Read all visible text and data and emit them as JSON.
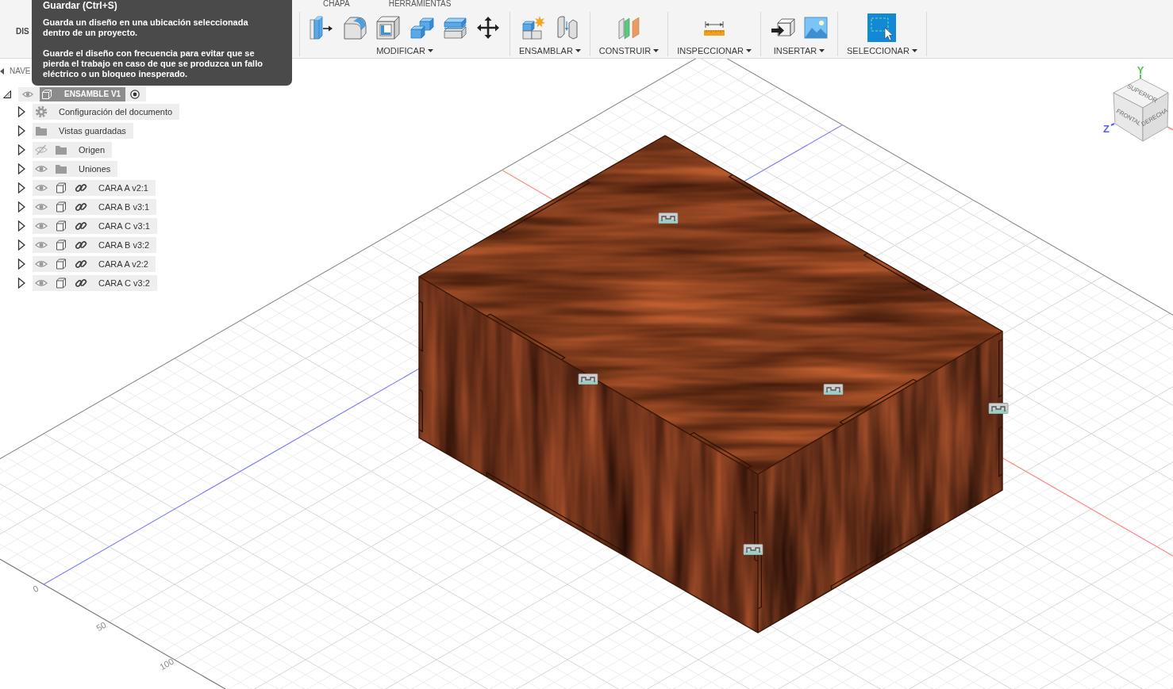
{
  "toolbar": {
    "workspace": "DIS",
    "tabs": [
      "CHAPA",
      "HERRAMIENTAS"
    ],
    "groups": [
      {
        "label": "MODIFICAR",
        "tools": [
          {
            "kind": "presspull"
          },
          {
            "kind": "fillet"
          },
          {
            "kind": "shell"
          },
          {
            "kind": "combine"
          },
          {
            "kind": "offset"
          },
          {
            "kind": "move"
          }
        ]
      },
      {
        "label": "ENSAMBLAR",
        "tools": [
          {
            "kind": "component"
          },
          {
            "kind": "joint"
          }
        ]
      },
      {
        "label": "CONSTRUIR",
        "tools": [
          {
            "kind": "plane"
          }
        ]
      },
      {
        "label": "INSPECCIONAR",
        "tools": [
          {
            "kind": "measure"
          }
        ]
      },
      {
        "label": "INSERTAR",
        "tools": [
          {
            "kind": "insert"
          },
          {
            "kind": "image"
          }
        ]
      },
      {
        "label": "SELECCIONAR",
        "tools": [
          {
            "kind": "select"
          }
        ]
      }
    ]
  },
  "tooltip": {
    "title": "Guardar (Ctrl+S)",
    "paragraphs": [
      "Guarda un diseño en una ubicación seleccionada dentro de un proyecto.",
      "Guarde el diseño con frecuencia para evitar que se pierda el trabajo en caso de que se produzca un fallo eléctrico o un bloqueo inesperado."
    ]
  },
  "browser": {
    "header": "NAVE",
    "root": {
      "label": "ENSAMBLE V1",
      "expanded": true,
      "visible": true,
      "children": [
        {
          "kind": "settings",
          "label": "Configuración del documento",
          "expanded": false
        },
        {
          "kind": "folder",
          "label": "Vistas guardadas",
          "expanded": false
        },
        {
          "kind": "folder",
          "label": "Origen",
          "expanded": false,
          "visible": false
        },
        {
          "kind": "folder",
          "label": "Uniones",
          "expanded": false,
          "visible": true
        },
        {
          "kind": "component",
          "label": "CARA A v2:1",
          "expanded": false,
          "visible": true
        },
        {
          "kind": "component",
          "label": "CARA B v3:1",
          "expanded": false,
          "visible": true
        },
        {
          "kind": "component",
          "label": "CARA C v3:1",
          "expanded": false,
          "visible": true
        },
        {
          "kind": "component",
          "label": "CARA B v3:2",
          "expanded": false,
          "visible": true
        },
        {
          "kind": "component",
          "label": "CARA A v2:2",
          "expanded": false,
          "visible": true
        },
        {
          "kind": "component",
          "label": "CARA C v3:2",
          "expanded": false,
          "visible": true
        }
      ]
    }
  },
  "viewport": {
    "ruler_labels": [
      "0",
      "50",
      "100"
    ],
    "view_cube": {
      "faces": [
        "SUPERIOR",
        "FRONTAL",
        "DERECHA"
      ],
      "axes": [
        {
          "label": "Y",
          "color": "#4fc84f"
        },
        {
          "label": "Z",
          "color": "#5a5aff"
        }
      ]
    }
  }
}
